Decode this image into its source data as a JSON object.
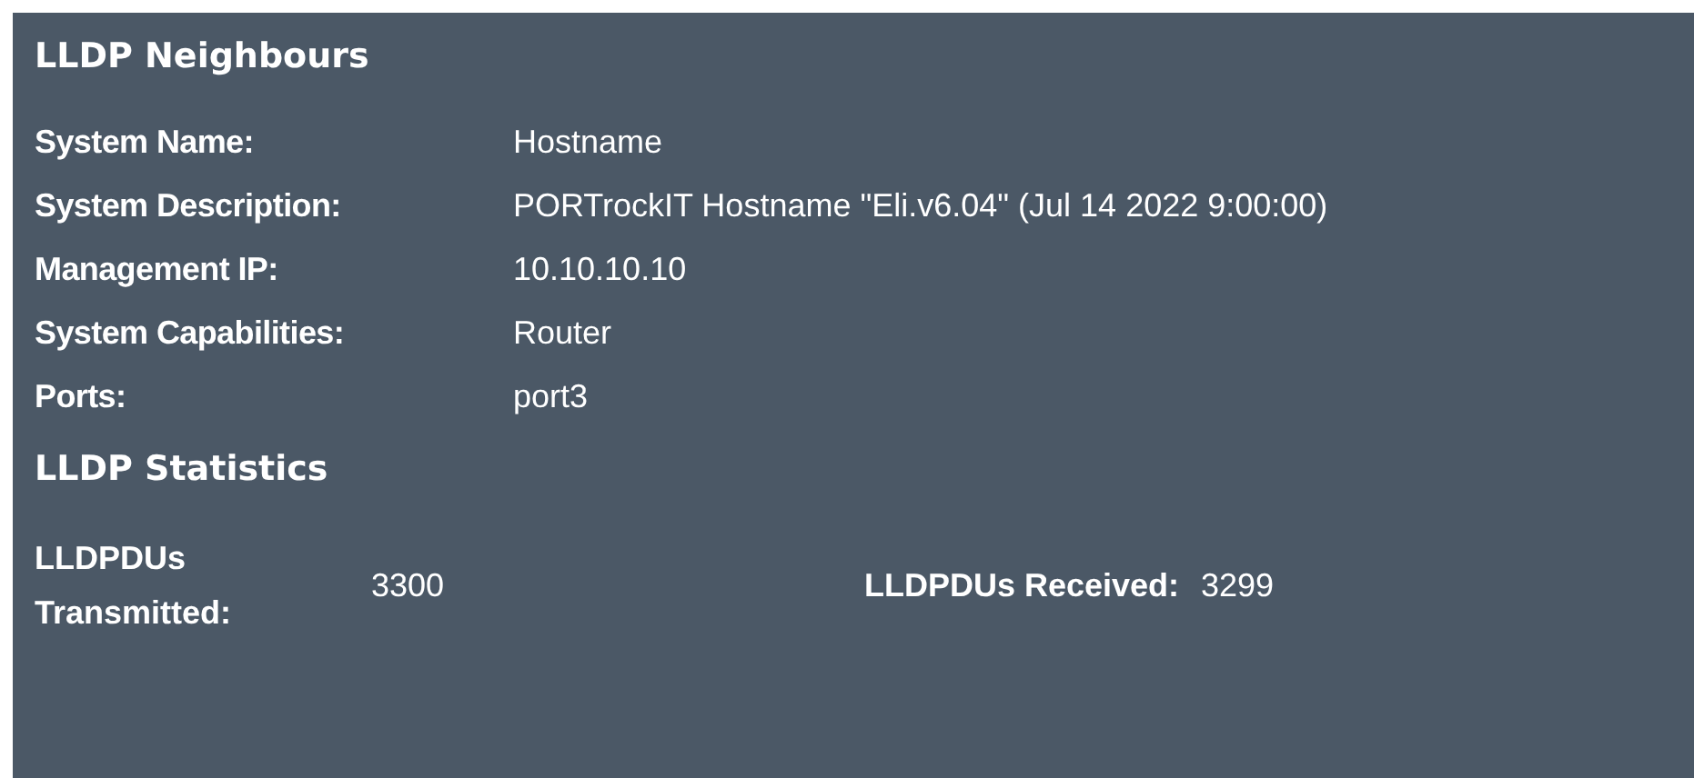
{
  "neighbours": {
    "title": "LLDP Neighbours",
    "fields": [
      {
        "label": "System Name:",
        "value": "Hostname"
      },
      {
        "label": "System Description:",
        "value": "PORTrockIT Hostname \"Eli.v6.04\" (Jul 14 2022 9:00:00)"
      },
      {
        "label": "Management IP:",
        "value": "10.10.10.10"
      },
      {
        "label": "System Capabilities:",
        "value": "Router"
      },
      {
        "label": "Ports:",
        "value": "port3"
      }
    ]
  },
  "statistics": {
    "title": "LLDP Statistics",
    "items": [
      {
        "label": "LLDPDUs Transmitted:",
        "value": "3300"
      },
      {
        "label": "LLDPDUs Received:",
        "value": "3299"
      }
    ]
  }
}
